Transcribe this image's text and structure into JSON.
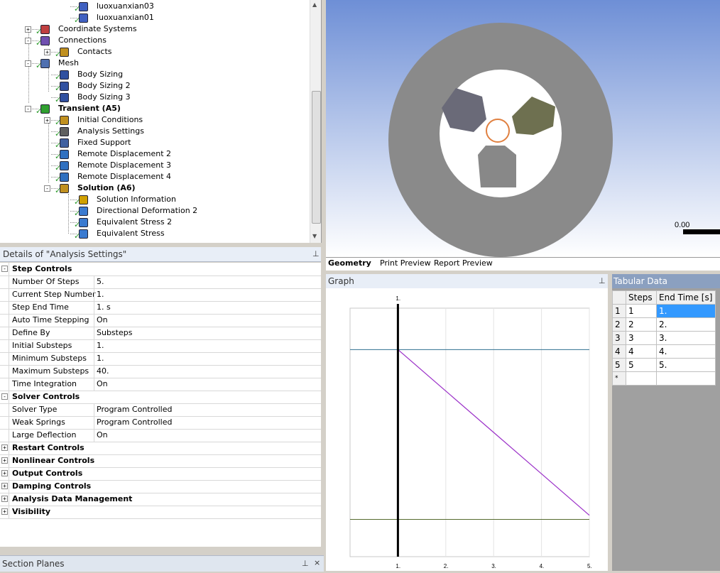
{
  "tree": {
    "items": [
      {
        "label": "luoxuanxian03",
        "level": 4,
        "y": 1,
        "bold": false,
        "icon": "body-icon",
        "toggle": ""
      },
      {
        "label": "luoxuanxian01",
        "level": 4,
        "y": 17,
        "bold": false,
        "icon": "body-icon",
        "toggle": ""
      },
      {
        "label": "Coordinate Systems",
        "level": 2,
        "y": 33,
        "bold": false,
        "icon": "coordinate-systems-icon",
        "toggle": "+"
      },
      {
        "label": "Connections",
        "level": 2,
        "y": 49,
        "bold": false,
        "icon": "connections-icon",
        "toggle": "-"
      },
      {
        "label": "Contacts",
        "level": 3,
        "y": 65,
        "bold": false,
        "icon": "contacts-icon",
        "toggle": "+"
      },
      {
        "label": "Mesh",
        "level": 2,
        "y": 81,
        "bold": false,
        "icon": "mesh-icon",
        "toggle": "-"
      },
      {
        "label": "Body Sizing",
        "level": 3,
        "y": 97,
        "bold": false,
        "icon": "sizing-icon",
        "toggle": ""
      },
      {
        "label": "Body Sizing 2",
        "level": 3,
        "y": 113,
        "bold": false,
        "icon": "sizing-icon",
        "toggle": ""
      },
      {
        "label": "Body Sizing 3",
        "level": 3,
        "y": 129,
        "bold": false,
        "icon": "sizing-icon",
        "toggle": ""
      },
      {
        "label": "Transient (A5)",
        "level": 2,
        "y": 145,
        "bold": true,
        "icon": "transient-icon",
        "toggle": "-"
      },
      {
        "label": "Initial Conditions",
        "level": 3,
        "y": 161,
        "bold": false,
        "icon": "initial-conditions-icon",
        "toggle": "+"
      },
      {
        "label": "Analysis Settings",
        "level": 3,
        "y": 177,
        "bold": false,
        "icon": "analysis-settings-icon",
        "toggle": ""
      },
      {
        "label": "Fixed Support",
        "level": 3,
        "y": 193,
        "bold": false,
        "icon": "fixed-support-icon",
        "toggle": ""
      },
      {
        "label": "Remote Displacement 2",
        "level": 3,
        "y": 209,
        "bold": false,
        "icon": "remote-displacement-icon",
        "toggle": ""
      },
      {
        "label": "Remote Displacement 3",
        "level": 3,
        "y": 225,
        "bold": false,
        "icon": "remote-displacement-icon",
        "toggle": ""
      },
      {
        "label": "Remote Displacement 4",
        "level": 3,
        "y": 241,
        "bold": false,
        "icon": "remote-displacement-icon",
        "toggle": ""
      },
      {
        "label": "Solution (A6)",
        "level": 3,
        "y": 257,
        "bold": true,
        "icon": "solution-icon",
        "toggle": "-"
      },
      {
        "label": "Solution Information",
        "level": 4,
        "y": 273,
        "bold": false,
        "icon": "solution-information-icon",
        "toggle": ""
      },
      {
        "label": "Directional Deformation 2",
        "level": 4,
        "y": 289,
        "bold": false,
        "icon": "result-icon",
        "toggle": ""
      },
      {
        "label": "Equivalent Stress 2",
        "level": 4,
        "y": 305,
        "bold": false,
        "icon": "result-icon",
        "toggle": ""
      },
      {
        "label": "Equivalent Stress",
        "level": 4,
        "y": 321,
        "bold": false,
        "icon": "result-icon",
        "toggle": ""
      }
    ]
  },
  "details": {
    "title": "Details of \"Analysis Settings\"",
    "rows": [
      {
        "type": "section",
        "label": "Step Controls",
        "expand": "-"
      },
      {
        "type": "prop",
        "label": "Number Of Steps",
        "value": "5."
      },
      {
        "type": "prop",
        "label": "Current Step Number",
        "value": "1."
      },
      {
        "type": "prop",
        "label": "Step End Time",
        "value": "1. s"
      },
      {
        "type": "prop",
        "label": "Auto Time Stepping",
        "value": "On"
      },
      {
        "type": "prop",
        "label": "Define By",
        "value": "Substeps"
      },
      {
        "type": "prop",
        "label": "Initial Substeps",
        "value": "1."
      },
      {
        "type": "prop",
        "label": "Minimum Substeps",
        "value": "1."
      },
      {
        "type": "prop",
        "label": "Maximum Substeps",
        "value": "40."
      },
      {
        "type": "prop",
        "label": "Time Integration",
        "value": "On"
      },
      {
        "type": "section",
        "label": "Solver Controls",
        "expand": "-"
      },
      {
        "type": "prop",
        "label": "Solver Type",
        "value": "Program Controlled"
      },
      {
        "type": "prop",
        "label": "Weak Springs",
        "value": "Program Controlled"
      },
      {
        "type": "prop",
        "label": "Large Deflection",
        "value": "On"
      },
      {
        "type": "section",
        "label": "Restart Controls",
        "expand": "+"
      },
      {
        "type": "section",
        "label": "Nonlinear Controls",
        "expand": "+"
      },
      {
        "type": "section",
        "label": "Output Controls",
        "expand": "+"
      },
      {
        "type": "section",
        "label": "Damping Controls",
        "expand": "+"
      },
      {
        "type": "section",
        "label": "Analysis Data Management",
        "expand": "+"
      },
      {
        "type": "section",
        "label": "Visibility",
        "expand": "+"
      }
    ]
  },
  "section_planes": {
    "title": "Section Planes"
  },
  "viewport": {
    "scale_label": "0.00"
  },
  "tabs": [
    "Geometry",
    "Print Preview",
    "Report Preview"
  ],
  "graph": {
    "title": "Graph",
    "marker_label": "1.",
    "tick_labels": [
      "1.",
      "2.",
      "3.",
      "4.",
      "5."
    ]
  },
  "chart_data": {
    "type": "line",
    "x": [
      1,
      2,
      3,
      4,
      5
    ],
    "values": [
      5,
      4,
      3,
      2,
      1
    ],
    "xlim": [
      0,
      5
    ],
    "ylim": [
      0,
      6
    ],
    "current_step": 1
  },
  "tabular": {
    "title": "Tabular Data",
    "headers": [
      "Steps",
      "End Time [s]"
    ],
    "rows": [
      {
        "n": "1",
        "step": "1",
        "time": "1."
      },
      {
        "n": "2",
        "step": "2",
        "time": "2."
      },
      {
        "n": "3",
        "step": "3",
        "time": "3."
      },
      {
        "n": "4",
        "step": "4",
        "time": "4."
      },
      {
        "n": "5",
        "step": "5",
        "time": "5."
      }
    ],
    "new_row_marker": "*"
  },
  "colors": {
    "ring": "#8a8a8a",
    "selection": "#3399ff",
    "graph_line": "#9b30c8",
    "check": "#2c9a2c"
  }
}
